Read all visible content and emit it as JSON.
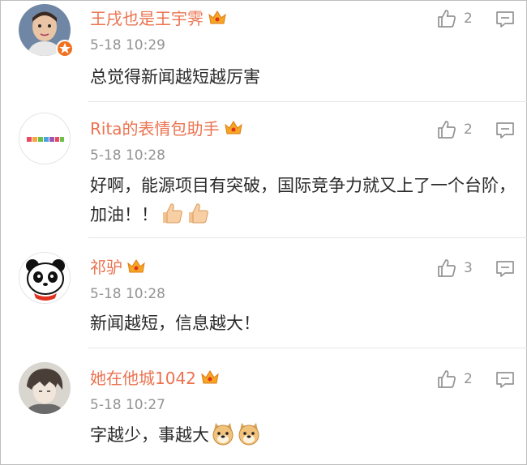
{
  "comments": [
    {
      "username": "王戌也是王宇霁",
      "time": "5-18 10:29",
      "text": "总觉得新闻越短越厉害",
      "likes": "2",
      "avatar": "child-photo-avatar",
      "verified_badge": true
    },
    {
      "username": "Rita的表情包助手",
      "time": "5-18 10:28",
      "text": "好啊，能源项目有突破，国际竞争力就又上了一个台阶，加油！！",
      "likes": "2",
      "avatar": "colorful-text-logo-avatar",
      "emojis": [
        "thumbs-up-emoji",
        "thumbs-up-emoji"
      ]
    },
    {
      "username": "祁驴",
      "time": "5-18 10:28",
      "text": "新闻越短，信息越大！",
      "likes": "3",
      "avatar": "panda-cartoon-avatar"
    },
    {
      "username": "她在他城1042",
      "time": "5-18 10:27",
      "text": "字越少，事越大",
      "likes": "2",
      "avatar": "anime-character-avatar",
      "emojis": [
        "doge-emoji",
        "doge-emoji"
      ]
    }
  ],
  "colors": {
    "username": "#eb7350",
    "time": "#939393",
    "text": "#2a2a2a",
    "crown": "#f5a623",
    "badge": "#f0711f"
  }
}
